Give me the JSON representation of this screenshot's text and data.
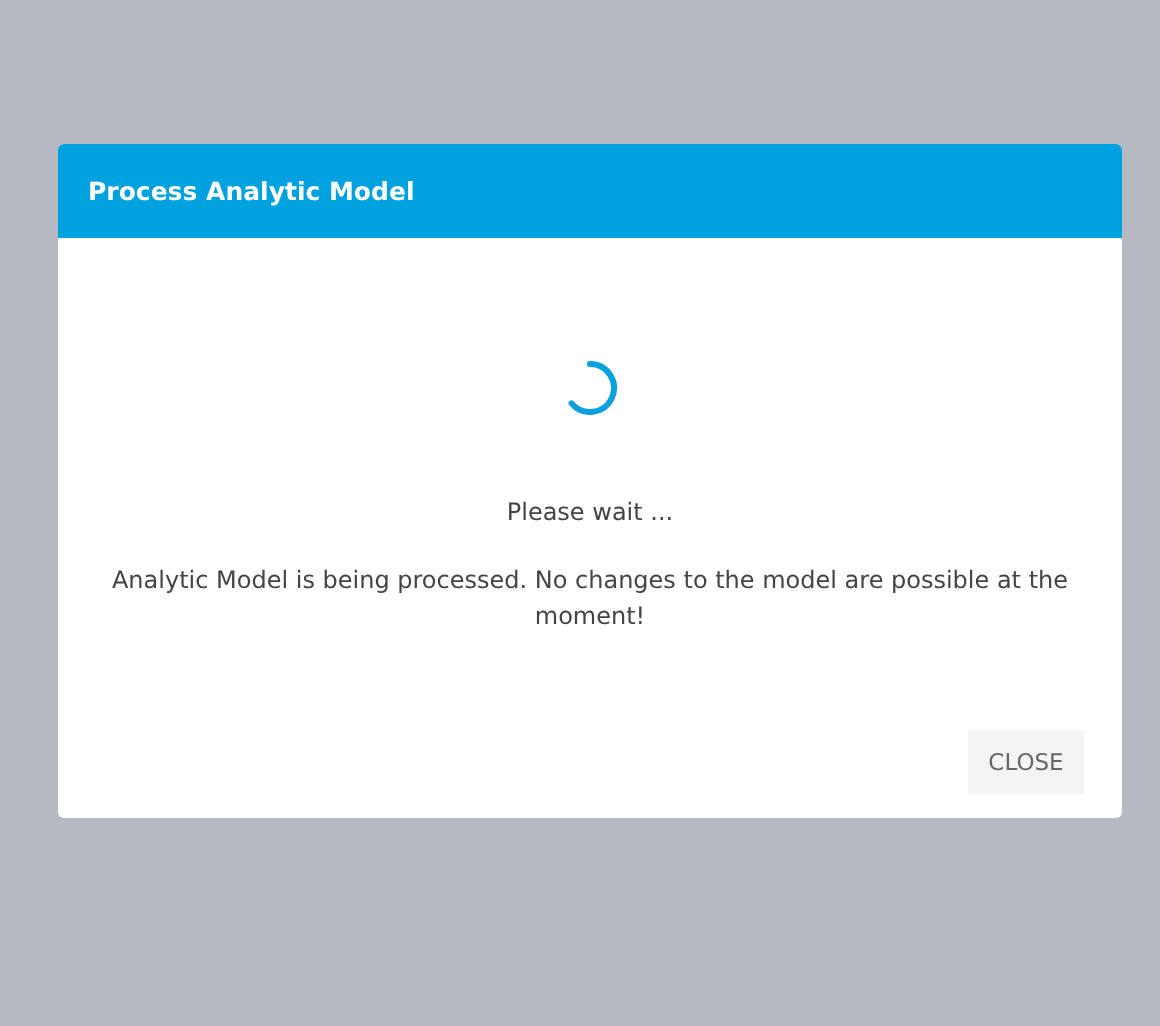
{
  "dialog": {
    "title": "Process Analytic Model",
    "status": "Please wait ...",
    "message": "Analytic Model is being processed. No changes to the model are possible at the moment!",
    "buttons": [
      "CLOSE"
    ]
  }
}
